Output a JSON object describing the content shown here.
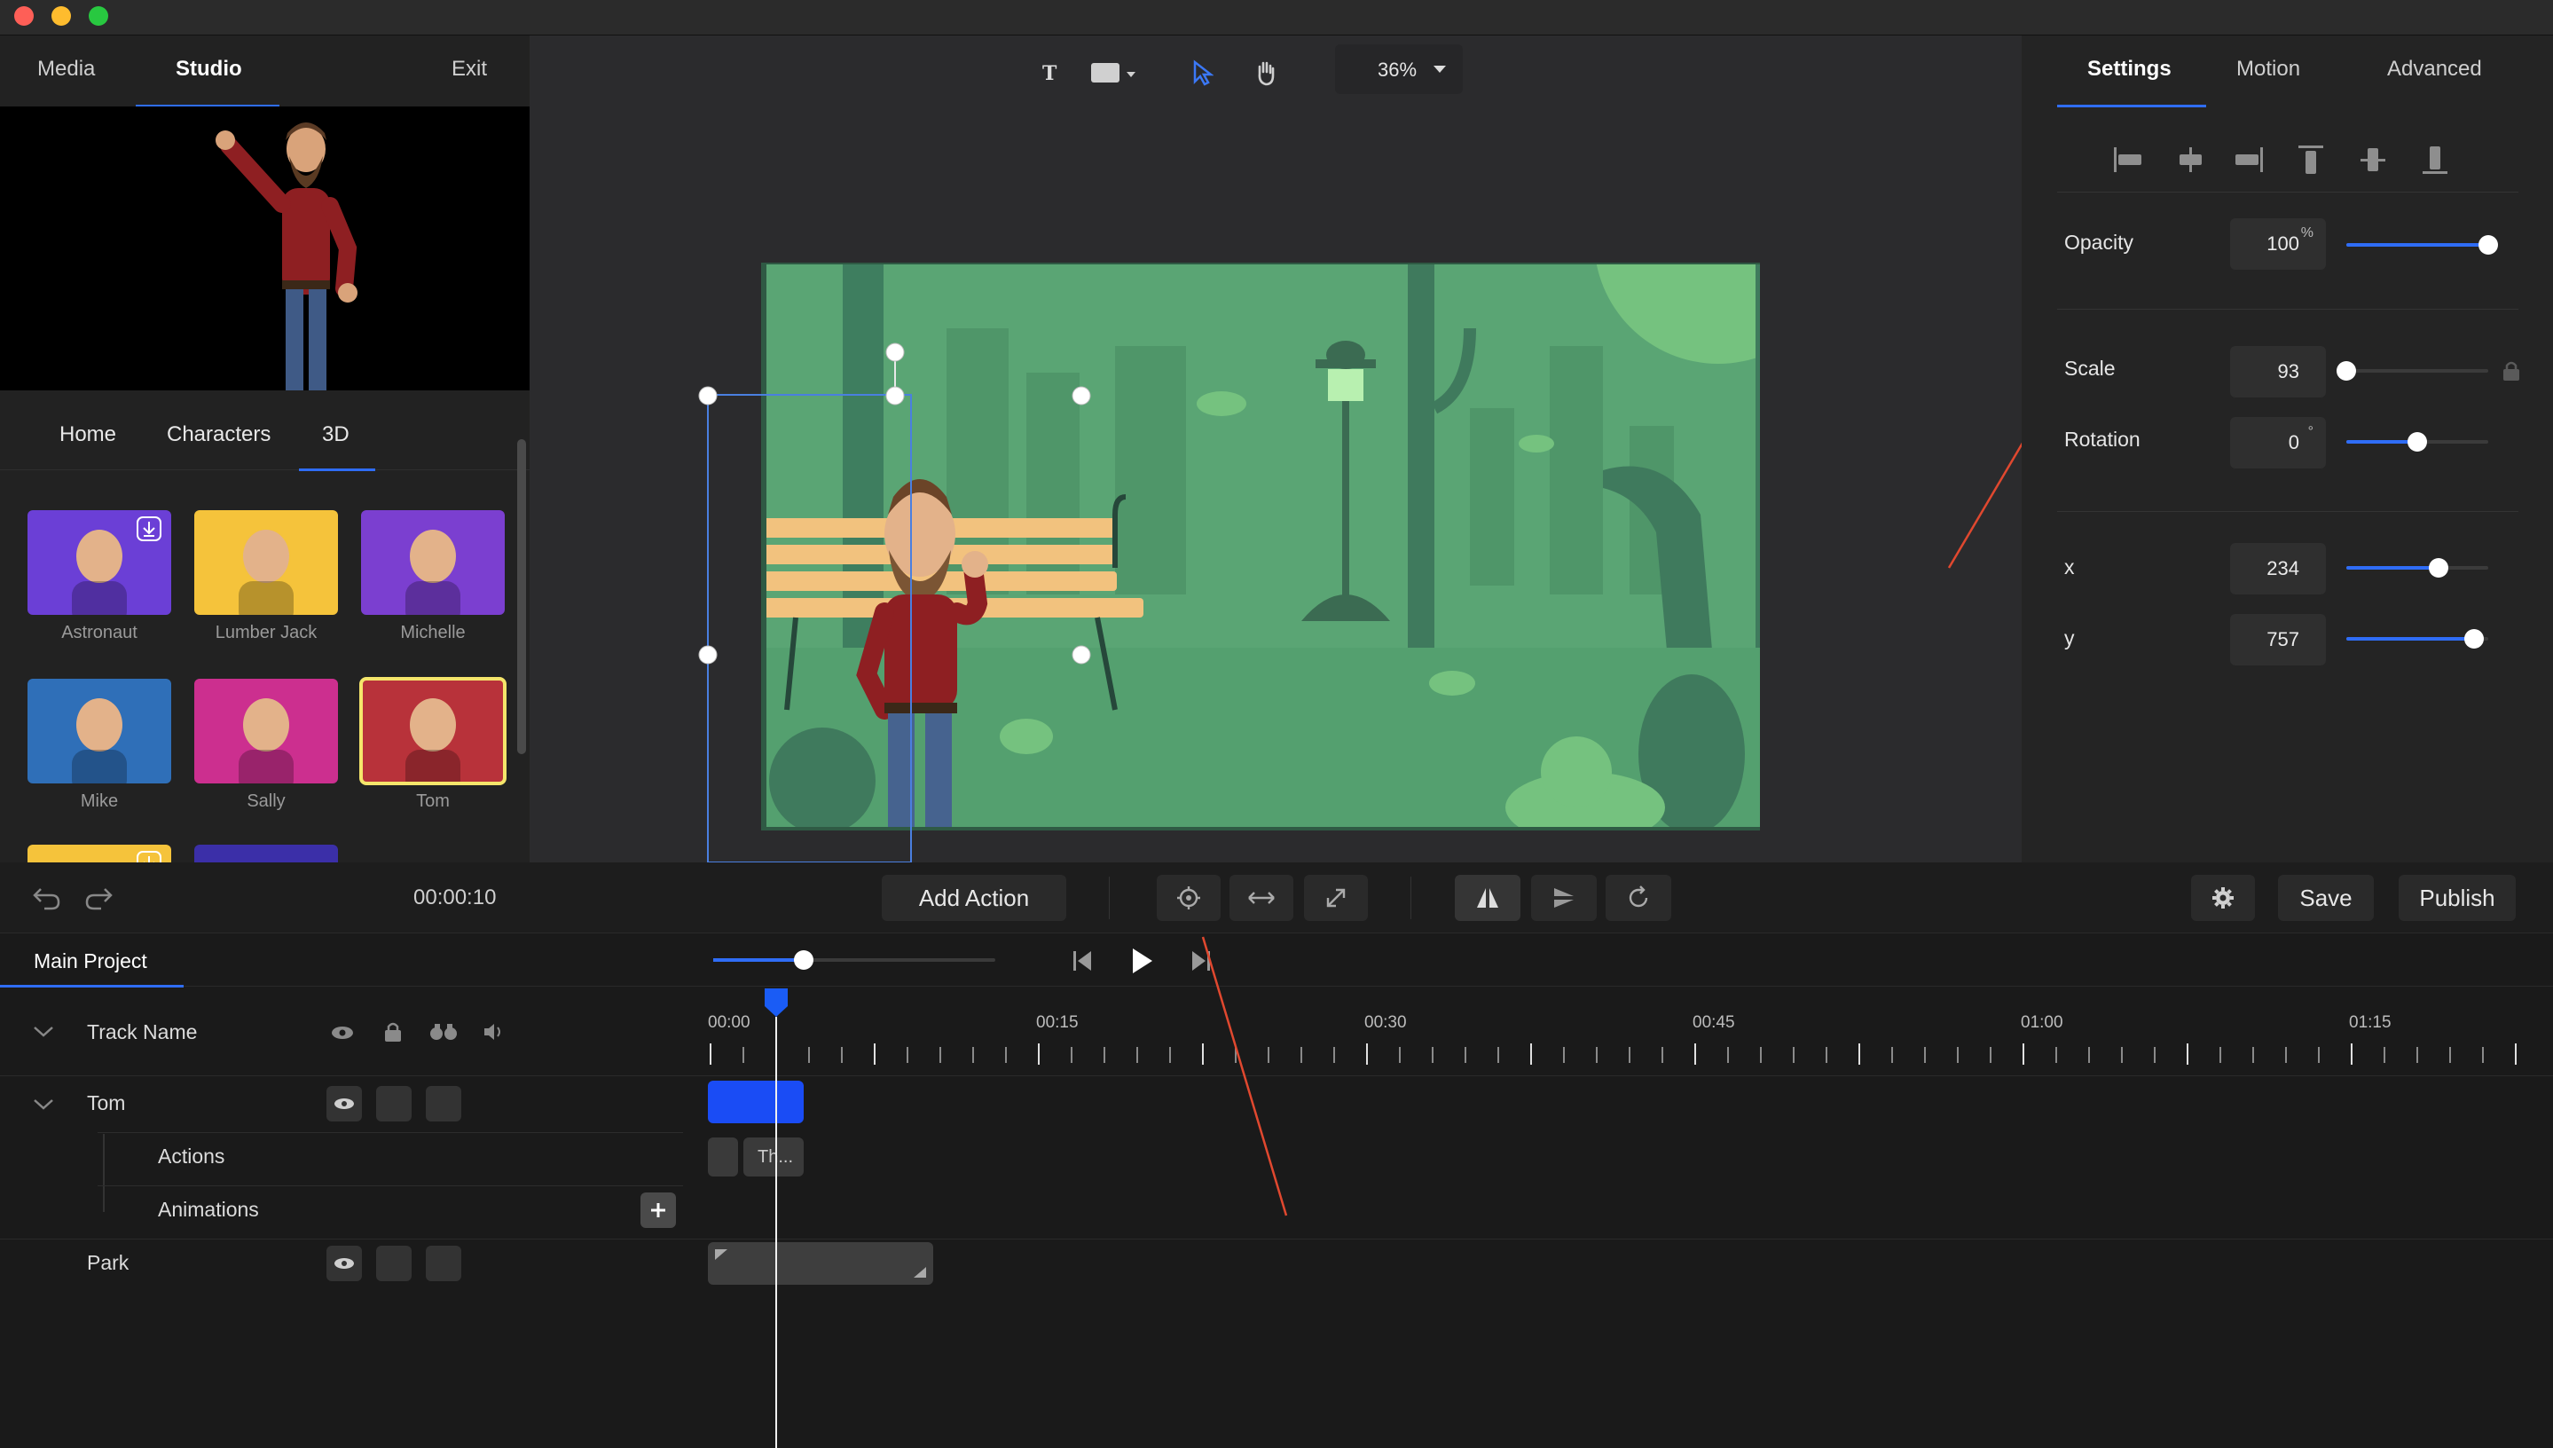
{
  "window": {
    "controls": [
      "close",
      "minimize",
      "zoom"
    ]
  },
  "left_panel": {
    "tabs": [
      {
        "label": "Media"
      },
      {
        "label": "Studio"
      }
    ],
    "exit_label": "Exit",
    "subtabs": [
      {
        "label": "Home"
      },
      {
        "label": "Characters"
      },
      {
        "label": "3D"
      }
    ],
    "characters": [
      {
        "name": "Astronaut",
        "bg": "#6b3fd6",
        "download": true
      },
      {
        "name": "Lumber Jack",
        "bg": "#f5c33b",
        "download": false
      },
      {
        "name": "Michelle",
        "bg": "#7b3fd0",
        "download": false
      },
      {
        "name": "Mike",
        "bg": "#2f6fb8",
        "download": false
      },
      {
        "name": "Sally",
        "bg": "#cc2f8f",
        "download": false
      },
      {
        "name": "Tom",
        "bg": "#b8323a",
        "download": false,
        "selected": true
      },
      {
        "name": "",
        "bg": "#f5c33b",
        "download": true
      },
      {
        "name": "",
        "bg": "#3b2fa8",
        "download": false
      }
    ]
  },
  "canvas": {
    "tools": [
      "text-tool-icon",
      "shape-tool-icon",
      "select-pointer-icon",
      "hand-pan-icon"
    ],
    "zoom": "36%",
    "bg_color": "#5aa574"
  },
  "right_panel": {
    "tabs": [
      {
        "label": "Settings"
      },
      {
        "label": "Motion"
      },
      {
        "label": "Advanced"
      }
    ],
    "align_icons": [
      "align-left-icon",
      "align-center-h-icon",
      "align-right-icon",
      "align-top-icon",
      "align-middle-v-icon",
      "align-bottom-icon"
    ],
    "properties": {
      "opacity": {
        "label": "Opacity",
        "value": "100",
        "unit": "%",
        "level": 1.0
      },
      "scale": {
        "label": "Scale",
        "value": "93",
        "unit": "",
        "level": 0.0
      },
      "rotation": {
        "label": "Rotation",
        "value": "0",
        "unit": "°",
        "level": 0.5
      },
      "x": {
        "label": "x",
        "value": "234",
        "unit": "",
        "level": 0.65
      },
      "y": {
        "label": "y",
        "value": "757",
        "unit": "",
        "level": 0.9
      }
    }
  },
  "toolbar": {
    "time": "00:00:10",
    "add_action": "Add Action",
    "save": "Save",
    "publish": "Publish"
  },
  "timeline": {
    "tab": "Main Project",
    "header_label": "Track Name",
    "ruler": [
      "00:00",
      "00:15",
      "00:30",
      "00:45",
      "01:00",
      "01:15"
    ],
    "playback_level": 0.32,
    "tracks": {
      "tom": "Tom",
      "actions": "Actions",
      "animations": "Animations",
      "park": "Park"
    },
    "action_clip_label": "Th..."
  },
  "colors": {
    "accent": "#2f6df6",
    "annotation_arrow": "#e0482f"
  }
}
